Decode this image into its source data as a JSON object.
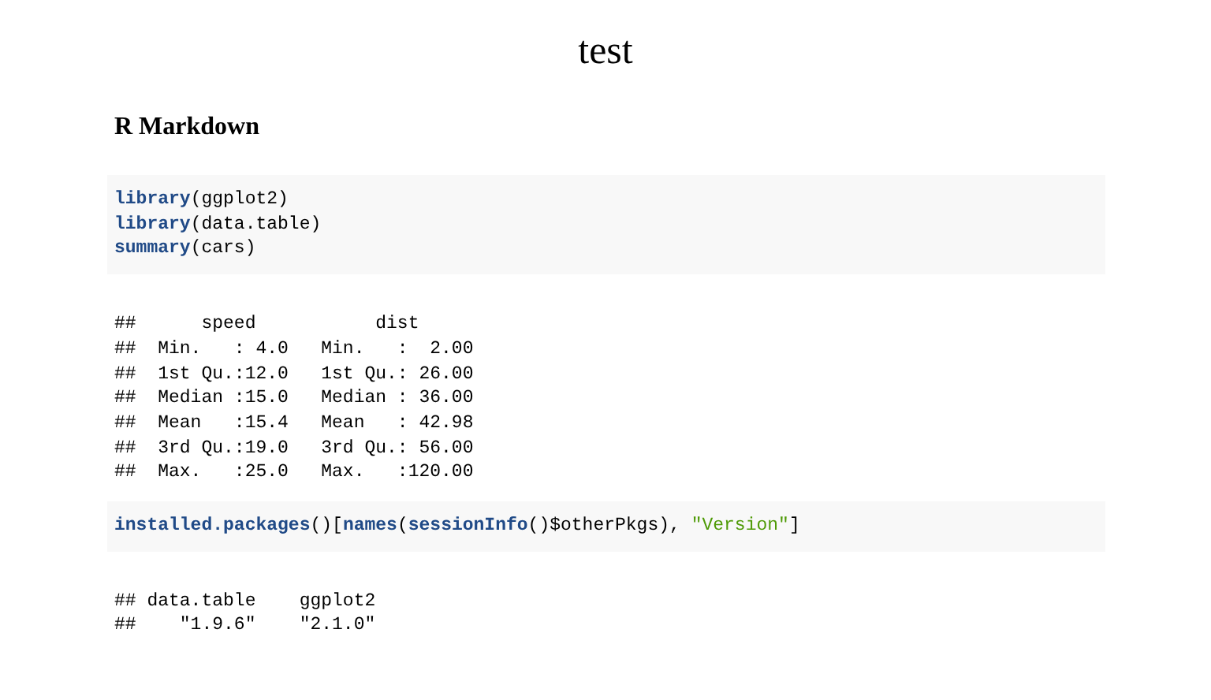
{
  "title": "test",
  "section": {
    "heading": "R Markdown"
  },
  "chunks": [
    {
      "kind": "code",
      "lines": [
        [
          {
            "kind": "function",
            "text": "library"
          },
          {
            "kind": "plain",
            "text": "(ggplot2)"
          }
        ],
        [
          {
            "kind": "function",
            "text": "library"
          },
          {
            "kind": "plain",
            "text": "(data.table)"
          }
        ],
        [
          {
            "kind": "function",
            "text": "summary"
          },
          {
            "kind": "plain",
            "text": "(cars)"
          }
        ]
      ]
    },
    {
      "kind": "output",
      "lines": [
        "##      speed           dist       ",
        "##  Min.   : 4.0   Min.   :  2.00  ",
        "##  1st Qu.:12.0   1st Qu.: 26.00  ",
        "##  Median :15.0   Median : 36.00  ",
        "##  Mean   :15.4   Mean   : 42.98  ",
        "##  3rd Qu.:19.0   3rd Qu.: 56.00  ",
        "##  Max.   :25.0   Max.   :120.00  "
      ]
    },
    {
      "kind": "code",
      "lines": [
        [
          {
            "kind": "function",
            "text": "installed.packages"
          },
          {
            "kind": "plain",
            "text": "()["
          },
          {
            "kind": "function",
            "text": "names"
          },
          {
            "kind": "plain",
            "text": "("
          },
          {
            "kind": "function",
            "text": "sessionInfo"
          },
          {
            "kind": "plain",
            "text": "()$otherPkgs), "
          },
          {
            "kind": "string",
            "text": "\"Version\""
          },
          {
            "kind": "plain",
            "text": "]"
          }
        ]
      ]
    },
    {
      "kind": "output",
      "lines": [
        "## data.table    ggplot2 ",
        "##    \"1.9.6\"    \"2.1.0\" "
      ]
    }
  ]
}
